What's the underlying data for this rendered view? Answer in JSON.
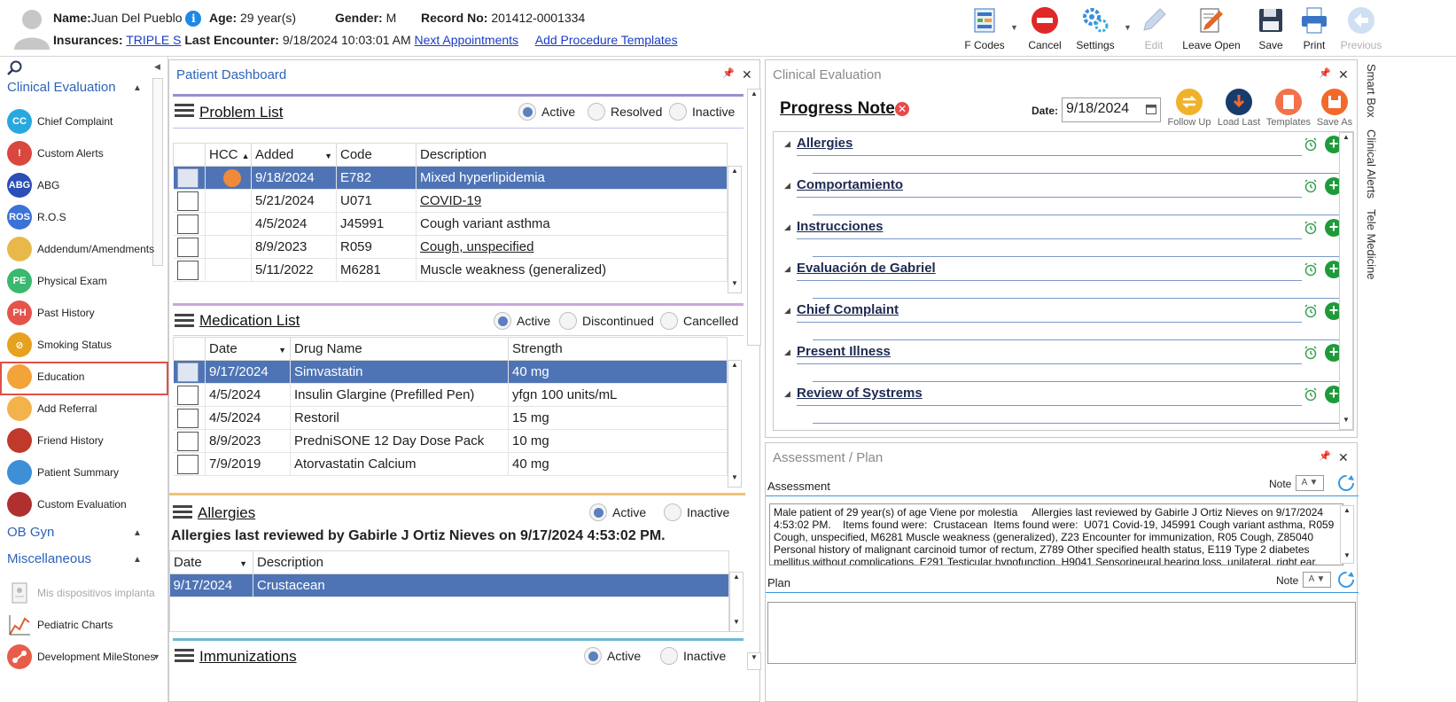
{
  "header": {
    "name_label": "Name:",
    "name_value": "Juan Del Pueblo",
    "age_label": "Age:",
    "age_value": "29 year(s)",
    "gender_label": "Gender:",
    "gender_value": "M",
    "record_label": "Record No:",
    "record_value": "201412-0001334",
    "insurances_label": "Insurances:",
    "insurances_value": "TRIPLE S",
    "last_encounter_label": "Last Encounter:",
    "last_encounter_value": "9/18/2024 10:03:01 AM",
    "next_appointments": "Next Appointments",
    "add_procedure_templates": "Add Procedure Templates"
  },
  "toolbar": {
    "fcodes": "F Codes",
    "cancel": "Cancel",
    "settings": "Settings",
    "edit": "Edit",
    "leave_open": "Leave Open",
    "save": "Save",
    "print": "Print",
    "previous": "Previous"
  },
  "sidebar": {
    "section_clinical": "Clinical Evaluation",
    "items": [
      {
        "label": "Chief Complaint",
        "abbr": "CC",
        "color": "#29a8e0"
      },
      {
        "label": "Custom Alerts",
        "abbr": "!",
        "color": "#d9473f"
      },
      {
        "label": "ABG",
        "abbr": "ABG",
        "color": "#2b4fb5"
      },
      {
        "label": "R.O.S",
        "abbr": "ROS",
        "color": "#3b72d8"
      },
      {
        "label": "Addendum/Amendments",
        "abbr": "",
        "color": "#e8b94a"
      },
      {
        "label": "Physical Exam",
        "abbr": "PE",
        "color": "#3ab86e"
      },
      {
        "label": "Past History",
        "abbr": "PH",
        "color": "#e5534b"
      },
      {
        "label": "Smoking Status",
        "abbr": "⊘",
        "color": "#e6a21e"
      },
      {
        "label": "Education",
        "abbr": "",
        "color": "#f2a33a"
      },
      {
        "label": "Add Referral",
        "abbr": "",
        "color": "#f4b24a"
      },
      {
        "label": "Friend History",
        "abbr": "",
        "color": "#c0392b"
      },
      {
        "label": "Patient Summary",
        "abbr": "",
        "color": "#3d8fd8"
      },
      {
        "label": "Custom Evaluation",
        "abbr": "",
        "color": "#b03030"
      }
    ],
    "section_obgyn": "OB Gyn",
    "section_misc": "Miscellaneous",
    "misc_items": [
      {
        "label": "Mis dispositivos implanta"
      },
      {
        "label": "Pediatric Charts"
      },
      {
        "label": "Development MileStones"
      }
    ]
  },
  "dashboard": {
    "title": "Patient Dashboard",
    "problem_list": {
      "title": "Problem List",
      "filters": [
        "Active",
        "Resolved",
        "Inactive"
      ],
      "columns": [
        "HCC",
        "Added",
        "Code",
        "Description"
      ],
      "rows": [
        {
          "added": "9/18/2024",
          "code": "E782",
          "desc": "Mixed hyperlipidemia"
        },
        {
          "added": "5/21/2024",
          "code": "U071",
          "desc": "COVID-19"
        },
        {
          "added": "4/5/2024",
          "code": "J45991",
          "desc": "Cough variant asthma"
        },
        {
          "added": "8/9/2023",
          "code": "R059",
          "desc": "Cough, unspecified"
        },
        {
          "added": "5/11/2022",
          "code": "M6281",
          "desc": "Muscle weakness (generalized)"
        }
      ]
    },
    "medication_list": {
      "title": "Medication List",
      "filters": [
        "Active",
        "Discontinued",
        "Cancelled"
      ],
      "columns": [
        "Date",
        "Drug Name",
        "Strength"
      ],
      "rows": [
        {
          "date": "9/17/2024",
          "drug": "Simvastatin",
          "strength": "40 mg"
        },
        {
          "date": "4/5/2024",
          "drug": "Insulin Glargine (Prefilled Pen)",
          "strength": "yfgn 100 units/mL"
        },
        {
          "date": "4/5/2024",
          "drug": "Restoril",
          "strength": "15 mg"
        },
        {
          "date": "8/9/2023",
          "drug": "PredniSONE 12 Day Dose Pack",
          "strength": "10 mg"
        },
        {
          "date": "7/9/2019",
          "drug": "Atorvastatin Calcium",
          "strength": "40 mg"
        }
      ]
    },
    "allergies": {
      "title": "Allergies",
      "filters": [
        "Active",
        "Inactive"
      ],
      "reviewed": "Allergies last reviewed by Gabirle J Ortiz Nieves on 9/17/2024 4:53:02 PM.",
      "columns": [
        "Date",
        "Description"
      ],
      "rows": [
        {
          "date": "9/17/2024",
          "desc": "Crustacean"
        }
      ]
    },
    "immunizations": {
      "title": "Immunizations",
      "filters": [
        "Active",
        "Inactive"
      ]
    }
  },
  "clinical_eval": {
    "title": "Clinical Evaluation",
    "note_title": "Progress Note",
    "date_label": "Date:",
    "date_value": "9/18/2024",
    "buttons": [
      "Follow Up",
      "Load Last",
      "Templates",
      "Save As"
    ],
    "sections": [
      "Allergies",
      "Comportamiento",
      "Instrucciones",
      "Evaluación de Gabriel",
      "Chief Complaint",
      "Present Illness",
      "Review of Systrems"
    ]
  },
  "assessment_plan": {
    "title": "Assessment / Plan",
    "assessment_label": "Assessment",
    "note_label": "Note",
    "assessment_text": "Male patient of 29 year(s) of age Viene por molestia     Allergies last reviewed by Gabirle J Ortiz Nieves on 9/17/2024 4:53:02 PM.    Items found were:  Crustacean  Items found were:  U071 Covid-19, J45991 Cough variant asthma, R059 Cough, unspecified, M6281 Muscle weakness (generalized), Z23 Encounter for immunization, R05 Cough, Z85040 Personal history of malignant carcinoid tumor of rectum, Z789 Other specified health status, E119 Type 2 diabetes mellitus without complications, E291 Testicular hypofunction, H9041 Sensorineural hearing loss, unilateral, right ear, with",
    "plan_label": "Plan",
    "plan_text": ""
  },
  "right_tabs": [
    "Smart Box",
    "Clinical Alerts",
    "Tele Medicine"
  ]
}
